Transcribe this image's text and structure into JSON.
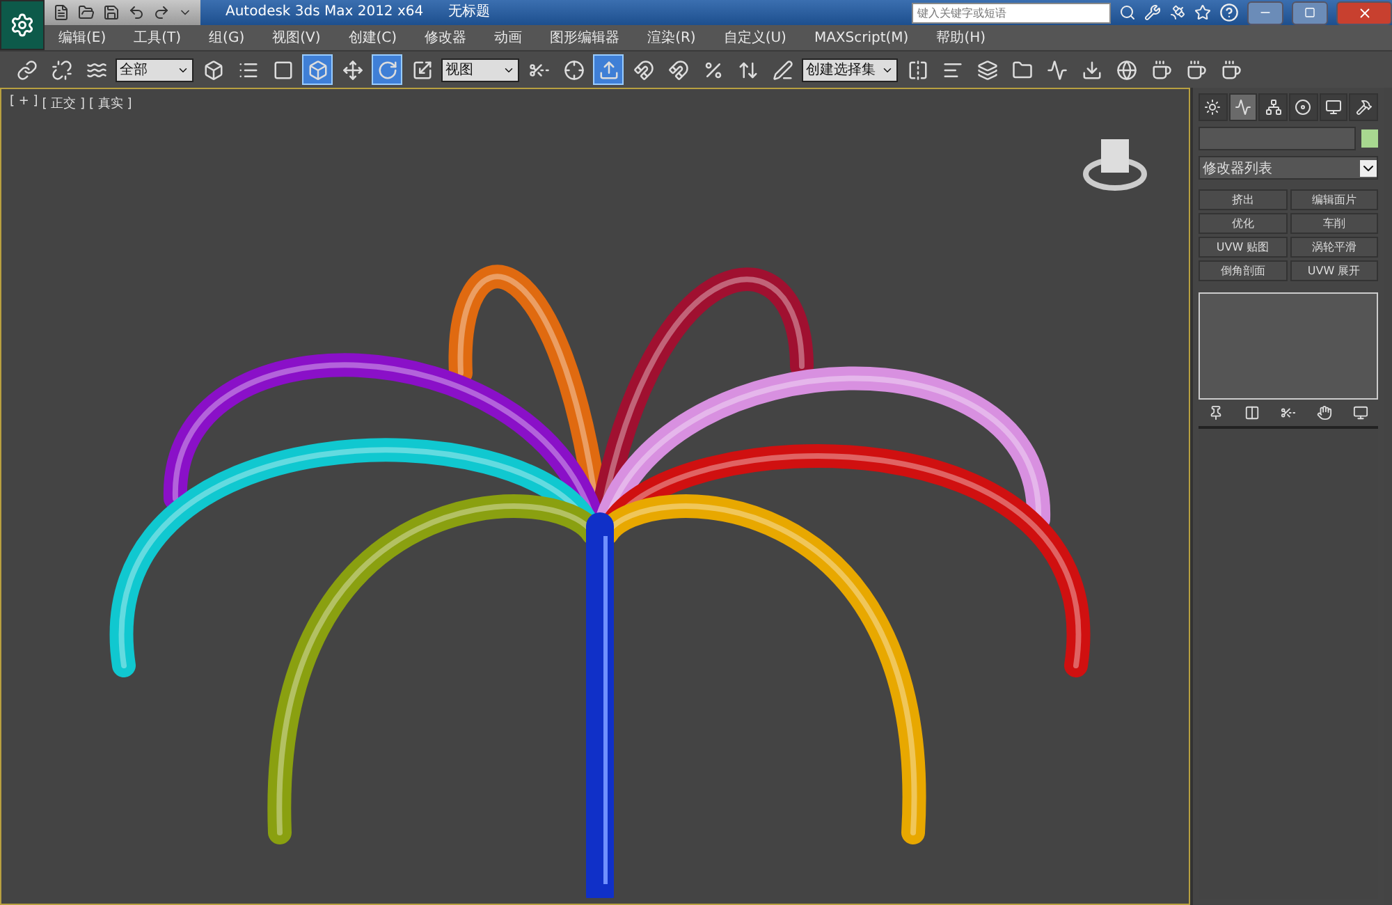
{
  "window": {
    "title": "Autodesk 3ds Max  2012 x64",
    "document": "无标题",
    "search": {
      "placeholder": "键入关键字或短语"
    }
  },
  "menu": [
    "编辑(E)",
    "工具(T)",
    "组(G)",
    "视图(V)",
    "创建(C)",
    "修改器",
    "动画",
    "图形编辑器",
    "渲染(R)",
    "自定义(U)",
    "MAXScript(M)",
    "帮助(H)"
  ],
  "toolbar": [
    {
      "kind": "button",
      "active": false
    },
    {
      "kind": "button",
      "active": false
    },
    {
      "kind": "button",
      "active": false
    },
    {
      "kind": "dropdown",
      "value": "全部"
    },
    {
      "kind": "button",
      "active": false
    },
    {
      "kind": "button",
      "active": false
    },
    {
      "kind": "button",
      "active": false
    },
    {
      "kind": "button",
      "active": true
    },
    {
      "kind": "button",
      "active": false
    },
    {
      "kind": "button",
      "active": true
    },
    {
      "kind": "button",
      "active": false
    },
    {
      "kind": "dropdown",
      "value": "视图"
    },
    {
      "kind": "button",
      "active": false
    },
    {
      "kind": "button",
      "active": false
    },
    {
      "kind": "button",
      "active": true
    },
    {
      "kind": "button",
      "active": false
    },
    {
      "kind": "button",
      "active": false
    },
    {
      "kind": "button",
      "active": false
    },
    {
      "kind": "button",
      "active": false
    },
    {
      "kind": "button",
      "active": false
    },
    {
      "kind": "dropdown",
      "value": "创建选择集"
    },
    {
      "kind": "button",
      "active": false
    },
    {
      "kind": "button",
      "active": false
    },
    {
      "kind": "button",
      "active": false
    },
    {
      "kind": "button",
      "active": false
    },
    {
      "kind": "button",
      "active": false
    },
    {
      "kind": "button",
      "active": false
    },
    {
      "kind": "button",
      "active": false
    },
    {
      "kind": "button",
      "active": false
    },
    {
      "kind": "button",
      "active": false
    },
    {
      "kind": "button",
      "active": false
    }
  ],
  "viewport": {
    "labels": [
      "[ + ]",
      "[ 正交 ]",
      "[ 真实 ]"
    ]
  },
  "command_panel": {
    "tabs": [
      {
        "selected": false
      },
      {
        "selected": true
      },
      {
        "selected": false
      },
      {
        "selected": false
      },
      {
        "selected": false
      },
      {
        "selected": false
      }
    ],
    "modifier_list": "修改器列表",
    "modifier_buttons": [
      "挤出",
      "编辑面片",
      "优化",
      "车削",
      "UVW 贴图",
      "涡轮平滑",
      "倒角剖面",
      "UVW 展开"
    ]
  }
}
